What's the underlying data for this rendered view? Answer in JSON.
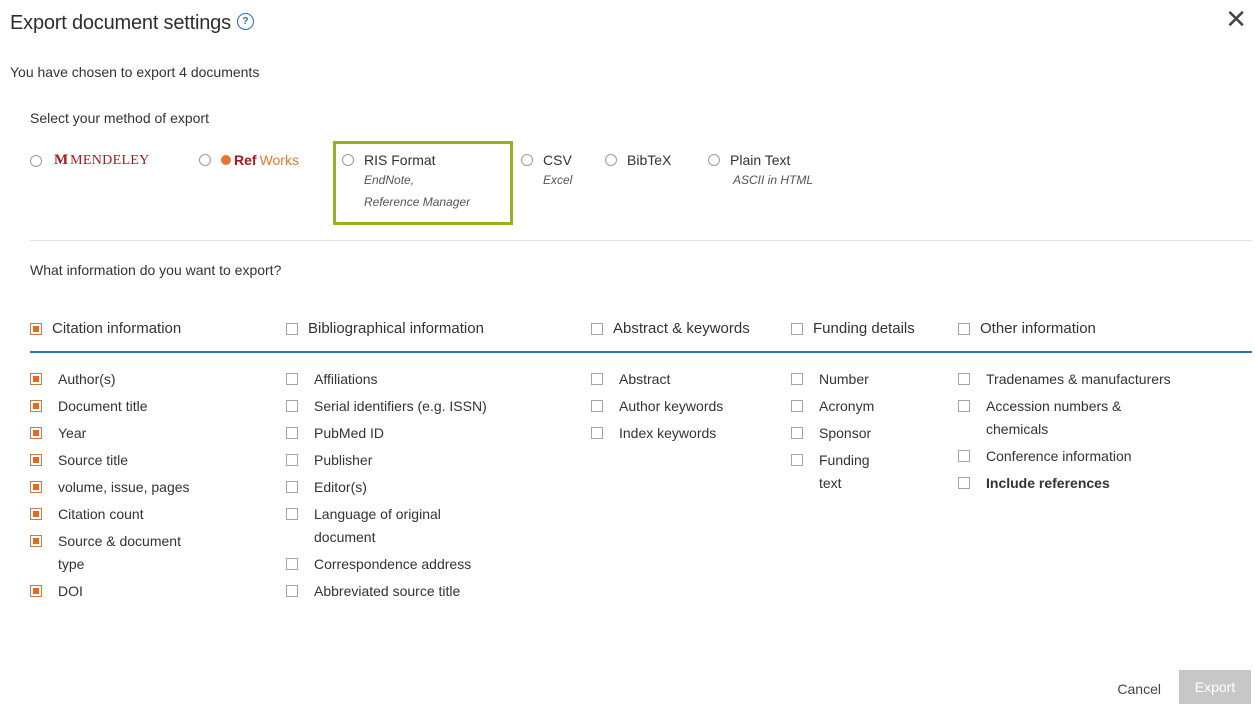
{
  "dialog": {
    "title": "Export document settings",
    "help_icon": "?",
    "close_icon": "✕",
    "subtitle": "You have chosen to export 4 documents"
  },
  "method": {
    "label": "Select your method of export",
    "options": [
      {
        "id": "mendeley",
        "label": "MENDELEY",
        "logo_mark": "M"
      },
      {
        "id": "refworks",
        "label_ref": "Ref",
        "label_works": "Works"
      },
      {
        "id": "ris",
        "label": "RIS Format",
        "sub1": "EndNote,",
        "sub2": "Reference Manager",
        "highlighted": true
      },
      {
        "id": "csv",
        "label": "CSV",
        "sub1": "Excel"
      },
      {
        "id": "bibtex",
        "label": "BibTeX"
      },
      {
        "id": "plain",
        "label": "Plain Text",
        "sub1": "ASCII in HTML"
      }
    ],
    "highlight_color": "#9ab01f"
  },
  "export_info": {
    "label": "What information do you want to export?",
    "columns": [
      {
        "header": "Citation information",
        "checked": true,
        "items": [
          {
            "label": "Author(s)",
            "checked": true
          },
          {
            "label": "Document title",
            "checked": true
          },
          {
            "label": "Year",
            "checked": true
          },
          {
            "label": "Source title",
            "checked": true
          },
          {
            "label": "volume, issue, pages",
            "checked": true
          },
          {
            "label": "Citation count",
            "checked": true
          },
          {
            "label": "Source & document",
            "label2": "type",
            "checked": true
          },
          {
            "label": "DOI",
            "checked": true
          }
        ]
      },
      {
        "header": "Bibliographical information",
        "checked": false,
        "items": [
          {
            "label": "Affiliations",
            "checked": false
          },
          {
            "label": "Serial identifiers (e.g. ISSN)",
            "checked": false
          },
          {
            "label": "PubMed ID",
            "checked": false
          },
          {
            "label": "Publisher",
            "checked": false
          },
          {
            "label": "Editor(s)",
            "checked": false
          },
          {
            "label": "Language of original",
            "label2": "document",
            "checked": false
          },
          {
            "label": "Correspondence address",
            "checked": false
          },
          {
            "label": "Abbreviated source title",
            "checked": false
          }
        ]
      },
      {
        "header": "Abstract & keywords",
        "checked": false,
        "items": [
          {
            "label": "Abstract",
            "checked": false
          },
          {
            "label": "Author keywords",
            "checked": false
          },
          {
            "label": "Index keywords",
            "checked": false
          }
        ]
      },
      {
        "header": "Funding details",
        "checked": false,
        "items": [
          {
            "label": "Number",
            "checked": false
          },
          {
            "label": "Acronym",
            "checked": false
          },
          {
            "label": "Sponsor",
            "checked": false
          },
          {
            "label": "Funding",
            "label2": "text",
            "checked": false
          }
        ]
      },
      {
        "header": "Other information",
        "checked": false,
        "items": [
          {
            "label": "Tradenames & manufacturers",
            "checked": false
          },
          {
            "label": "Accession numbers &",
            "label2": "chemicals",
            "checked": false
          },
          {
            "label": "Conference information",
            "checked": false
          },
          {
            "label": "Include references",
            "checked": false,
            "bold": true
          }
        ]
      }
    ]
  },
  "footer": {
    "cancel_label": "Cancel",
    "export_label": "Export"
  },
  "colors": {
    "accent_blue": "#2b73ad",
    "checkbox_orange": "#e8681f",
    "mendeley_red": "#a5191e",
    "export_disabled": "#c7c7c7"
  }
}
